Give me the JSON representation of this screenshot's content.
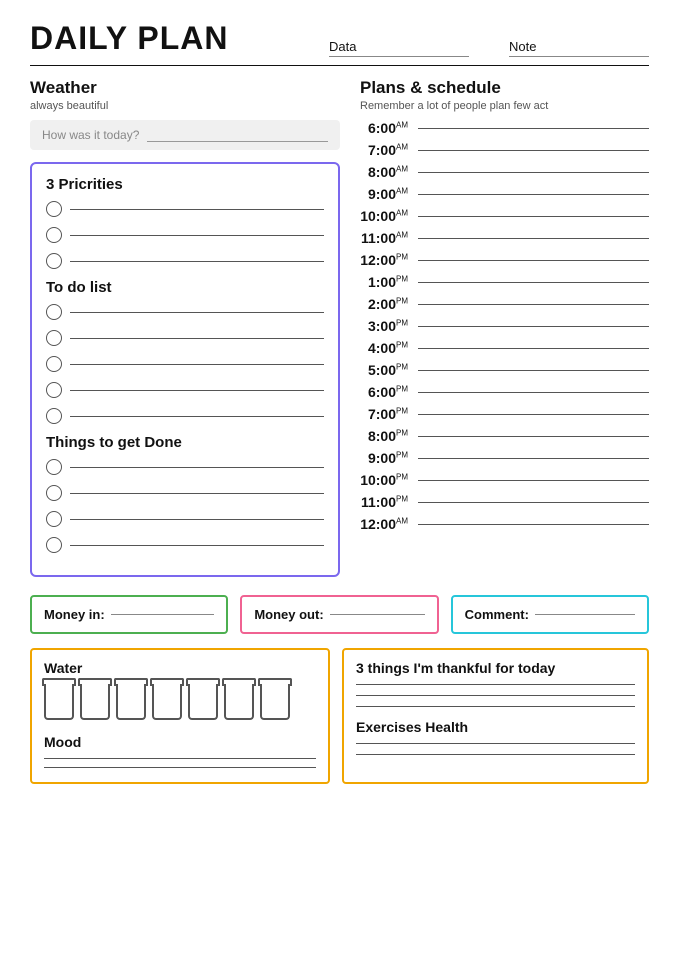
{
  "header": {
    "title": "DAILY PLAN",
    "data_label": "Data",
    "note_label": "Note"
  },
  "weather": {
    "title": "Weather",
    "subtitle": "always beautiful",
    "input_label": "How was it today?"
  },
  "priorities": {
    "title": "3 Pricrities",
    "items": [
      "",
      "",
      ""
    ]
  },
  "todo": {
    "title": "To do list",
    "items": [
      "",
      "",
      "",
      "",
      ""
    ]
  },
  "things": {
    "title": "Things to get Done",
    "items": [
      "",
      "",
      "",
      ""
    ]
  },
  "schedule": {
    "title": "Plans & schedule",
    "subtitle": "Remember a lot of people plan few act",
    "times": [
      {
        "hour": "6:00",
        "suffix": "AM"
      },
      {
        "hour": "7:00",
        "suffix": "AM"
      },
      {
        "hour": "8:00",
        "suffix": "AM"
      },
      {
        "hour": "9:00",
        "suffix": "AM"
      },
      {
        "hour": "10:00",
        "suffix": "AM"
      },
      {
        "hour": "11:00",
        "suffix": "AM"
      },
      {
        "hour": "12:00",
        "suffix": "PM"
      },
      {
        "hour": "1:00",
        "suffix": "PM"
      },
      {
        "hour": "2:00",
        "suffix": "PM"
      },
      {
        "hour": "3:00",
        "suffix": "PM"
      },
      {
        "hour": "4:00",
        "suffix": "PM"
      },
      {
        "hour": "5:00",
        "suffix": "PM"
      },
      {
        "hour": "6:00",
        "suffix": "PM"
      },
      {
        "hour": "7:00",
        "suffix": "PM"
      },
      {
        "hour": "8:00",
        "suffix": "PM"
      },
      {
        "hour": "9:00",
        "suffix": "PM"
      },
      {
        "hour": "10:00",
        "suffix": "PM"
      },
      {
        "hour": "11:00",
        "suffix": "PM"
      },
      {
        "hour": "12:00",
        "suffix": "AM"
      }
    ]
  },
  "money": {
    "in_label": "Money in:",
    "out_label": "Money out:",
    "comment_label": "Comment:"
  },
  "water": {
    "title": "Water",
    "cup_count": 7
  },
  "mood": {
    "title": "Mood"
  },
  "thankful": {
    "title": "3 things I'm thankful for today",
    "line_count": 3
  },
  "exercises": {
    "title": "Exercises Health",
    "line_count": 2
  }
}
